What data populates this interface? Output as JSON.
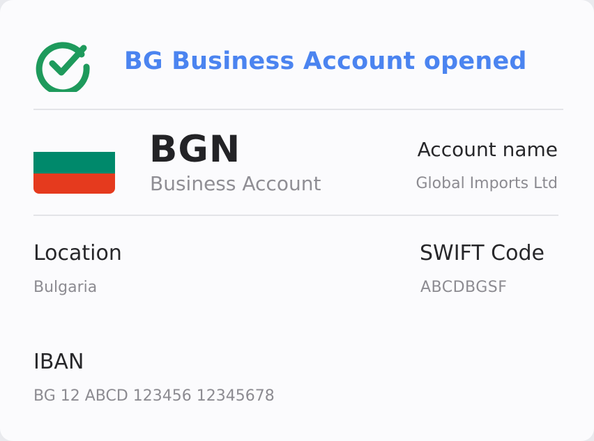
{
  "header": {
    "title": "BG Business Account opened",
    "status_icon": "check-circle-icon"
  },
  "account": {
    "currency": "BGN",
    "type": "Business Account",
    "flag": {
      "country": "Bulgaria",
      "colors": [
        "#00896b",
        "#e53a1e"
      ]
    },
    "account_name_label": "Account name",
    "account_name_value": "Global Imports Ltd"
  },
  "details": {
    "location_label": "Location",
    "location_value": "Bulgaria",
    "swift_label": "SWIFT Code",
    "swift_value": "ABCDBGSF",
    "iban_label": "IBAN",
    "iban_value": "BG 12 ABCD 123456 12345678"
  },
  "colors": {
    "accent": "#4b84f0",
    "success": "#1e9a5c",
    "flag_green": "#00896b",
    "flag_red": "#e53a1e"
  }
}
